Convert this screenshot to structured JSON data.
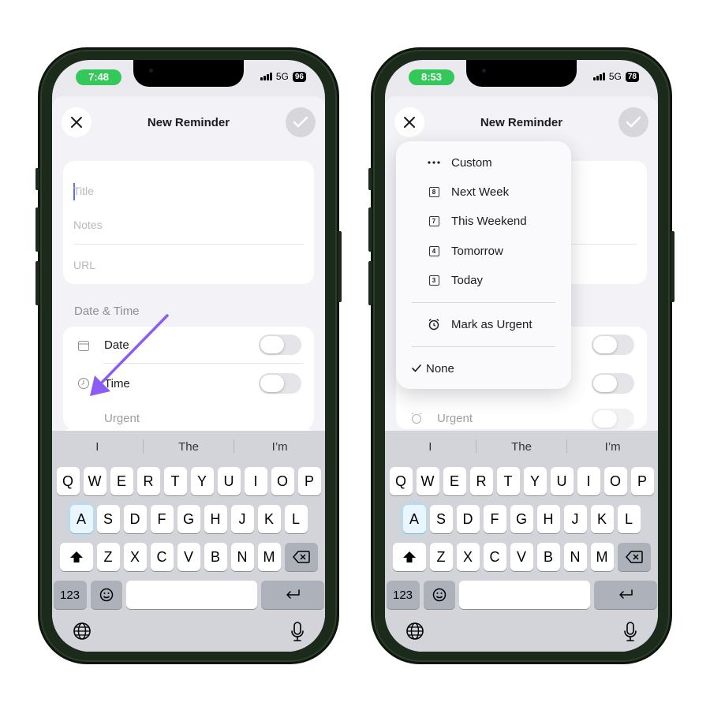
{
  "left": {
    "time": "7:48",
    "network": "5G",
    "battery": "96",
    "header_title": "New Reminder",
    "fields": {
      "title_placeholder": "Title",
      "notes_placeholder": "Notes",
      "url_placeholder": "URL"
    },
    "section": "Date & Time",
    "rows": {
      "date": "Date",
      "time": "Time",
      "urgent": "Urgent"
    },
    "suggestions": [
      "I",
      "The",
      "I’m"
    ]
  },
  "right": {
    "time": "8:53",
    "network": "5G",
    "battery": "78",
    "header_title": "New Reminder",
    "urgent_row": "Urgent",
    "suggestions": [
      "I",
      "The",
      "I’m"
    ],
    "menu": {
      "items": [
        {
          "label": "Custom",
          "icon": "ellipsis-icon"
        },
        {
          "label": "Next Week",
          "icon": "calendar-8-icon",
          "day": "8"
        },
        {
          "label": "This Weekend",
          "icon": "calendar-7-icon",
          "day": "7"
        },
        {
          "label": "Tomorrow",
          "icon": "calendar-4-icon",
          "day": "4"
        },
        {
          "label": "Today",
          "icon": "calendar-3-icon",
          "day": "3"
        }
      ],
      "urgent": "Mark as Urgent",
      "none": "None"
    }
  },
  "keyboard": {
    "row1": [
      "Q",
      "W",
      "E",
      "R",
      "T",
      "Y",
      "U",
      "I",
      "O",
      "P"
    ],
    "row2": [
      "A",
      "S",
      "D",
      "F",
      "G",
      "H",
      "J",
      "K",
      "L"
    ],
    "row3": [
      "Z",
      "X",
      "C",
      "V",
      "B",
      "N",
      "M"
    ],
    "numbers_key": "123"
  },
  "colors": {
    "time_pill": "#34c759",
    "arrow": "#8b5cf6",
    "cursor": "#5b6fff"
  }
}
